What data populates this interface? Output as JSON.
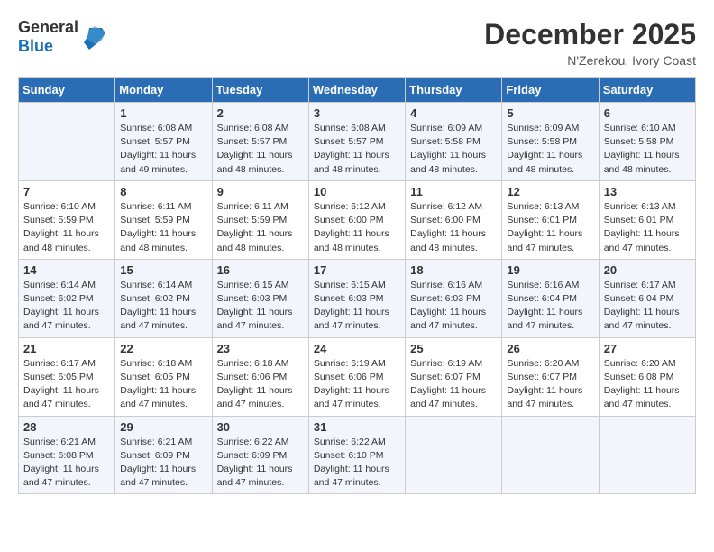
{
  "header": {
    "logo_general": "General",
    "logo_blue": "Blue",
    "month": "December 2025",
    "location": "N'Zerekou, Ivory Coast"
  },
  "days_of_week": [
    "Sunday",
    "Monday",
    "Tuesday",
    "Wednesday",
    "Thursday",
    "Friday",
    "Saturday"
  ],
  "weeks": [
    [
      {
        "day": "",
        "empty": true
      },
      {
        "day": "1",
        "sunrise": "6:08 AM",
        "sunset": "5:57 PM",
        "daylight": "11 hours and 49 minutes."
      },
      {
        "day": "2",
        "sunrise": "6:08 AM",
        "sunset": "5:57 PM",
        "daylight": "11 hours and 48 minutes."
      },
      {
        "day": "3",
        "sunrise": "6:08 AM",
        "sunset": "5:57 PM",
        "daylight": "11 hours and 48 minutes."
      },
      {
        "day": "4",
        "sunrise": "6:09 AM",
        "sunset": "5:58 PM",
        "daylight": "11 hours and 48 minutes."
      },
      {
        "day": "5",
        "sunrise": "6:09 AM",
        "sunset": "5:58 PM",
        "daylight": "11 hours and 48 minutes."
      },
      {
        "day": "6",
        "sunrise": "6:10 AM",
        "sunset": "5:58 PM",
        "daylight": "11 hours and 48 minutes."
      }
    ],
    [
      {
        "day": "7",
        "sunrise": "6:10 AM",
        "sunset": "5:59 PM",
        "daylight": "11 hours and 48 minutes."
      },
      {
        "day": "8",
        "sunrise": "6:11 AM",
        "sunset": "5:59 PM",
        "daylight": "11 hours and 48 minutes."
      },
      {
        "day": "9",
        "sunrise": "6:11 AM",
        "sunset": "5:59 PM",
        "daylight": "11 hours and 48 minutes."
      },
      {
        "day": "10",
        "sunrise": "6:12 AM",
        "sunset": "6:00 PM",
        "daylight": "11 hours and 48 minutes."
      },
      {
        "day": "11",
        "sunrise": "6:12 AM",
        "sunset": "6:00 PM",
        "daylight": "11 hours and 48 minutes."
      },
      {
        "day": "12",
        "sunrise": "6:13 AM",
        "sunset": "6:01 PM",
        "daylight": "11 hours and 47 minutes."
      },
      {
        "day": "13",
        "sunrise": "6:13 AM",
        "sunset": "6:01 PM",
        "daylight": "11 hours and 47 minutes."
      }
    ],
    [
      {
        "day": "14",
        "sunrise": "6:14 AM",
        "sunset": "6:02 PM",
        "daylight": "11 hours and 47 minutes."
      },
      {
        "day": "15",
        "sunrise": "6:14 AM",
        "sunset": "6:02 PM",
        "daylight": "11 hours and 47 minutes."
      },
      {
        "day": "16",
        "sunrise": "6:15 AM",
        "sunset": "6:03 PM",
        "daylight": "11 hours and 47 minutes."
      },
      {
        "day": "17",
        "sunrise": "6:15 AM",
        "sunset": "6:03 PM",
        "daylight": "11 hours and 47 minutes."
      },
      {
        "day": "18",
        "sunrise": "6:16 AM",
        "sunset": "6:03 PM",
        "daylight": "11 hours and 47 minutes."
      },
      {
        "day": "19",
        "sunrise": "6:16 AM",
        "sunset": "6:04 PM",
        "daylight": "11 hours and 47 minutes."
      },
      {
        "day": "20",
        "sunrise": "6:17 AM",
        "sunset": "6:04 PM",
        "daylight": "11 hours and 47 minutes."
      }
    ],
    [
      {
        "day": "21",
        "sunrise": "6:17 AM",
        "sunset": "6:05 PM",
        "daylight": "11 hours and 47 minutes."
      },
      {
        "day": "22",
        "sunrise": "6:18 AM",
        "sunset": "6:05 PM",
        "daylight": "11 hours and 47 minutes."
      },
      {
        "day": "23",
        "sunrise": "6:18 AM",
        "sunset": "6:06 PM",
        "daylight": "11 hours and 47 minutes."
      },
      {
        "day": "24",
        "sunrise": "6:19 AM",
        "sunset": "6:06 PM",
        "daylight": "11 hours and 47 minutes."
      },
      {
        "day": "25",
        "sunrise": "6:19 AM",
        "sunset": "6:07 PM",
        "daylight": "11 hours and 47 minutes."
      },
      {
        "day": "26",
        "sunrise": "6:20 AM",
        "sunset": "6:07 PM",
        "daylight": "11 hours and 47 minutes."
      },
      {
        "day": "27",
        "sunrise": "6:20 AM",
        "sunset": "6:08 PM",
        "daylight": "11 hours and 47 minutes."
      }
    ],
    [
      {
        "day": "28",
        "sunrise": "6:21 AM",
        "sunset": "6:08 PM",
        "daylight": "11 hours and 47 minutes."
      },
      {
        "day": "29",
        "sunrise": "6:21 AM",
        "sunset": "6:09 PM",
        "daylight": "11 hours and 47 minutes."
      },
      {
        "day": "30",
        "sunrise": "6:22 AM",
        "sunset": "6:09 PM",
        "daylight": "11 hours and 47 minutes."
      },
      {
        "day": "31",
        "sunrise": "6:22 AM",
        "sunset": "6:10 PM",
        "daylight": "11 hours and 47 minutes."
      },
      {
        "day": "",
        "empty": true
      },
      {
        "day": "",
        "empty": true
      },
      {
        "day": "",
        "empty": true
      }
    ]
  ],
  "labels": {
    "sunrise": "Sunrise:",
    "sunset": "Sunset:",
    "daylight": "Daylight:"
  }
}
